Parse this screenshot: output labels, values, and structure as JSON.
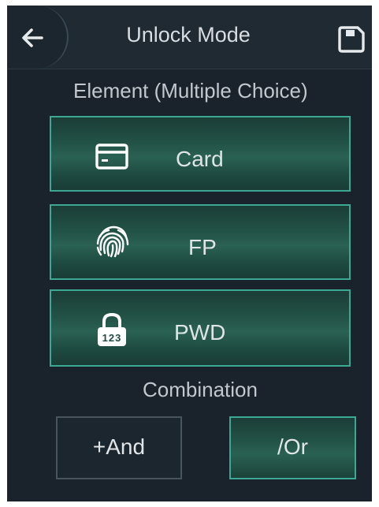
{
  "header": {
    "title": "Unlock Mode",
    "back_icon": "arrow-left-icon",
    "save_icon": "save-icon"
  },
  "element_section": {
    "label": "Element (Multiple Choice)",
    "options": [
      {
        "label": "Card",
        "icon": "card-icon",
        "selected": true
      },
      {
        "label": "FP",
        "icon": "fingerprint-icon",
        "selected": true
      },
      {
        "label": "PWD",
        "icon": "password-lock-icon",
        "selected": true
      }
    ]
  },
  "combination_section": {
    "label": "Combination",
    "and_label": "+And",
    "or_label": "/Or",
    "selected": "or"
  },
  "colors": {
    "background": "#1a232b",
    "accent_border": "#3aa892",
    "selected_fill": "#235347",
    "text": "#dfe4e6"
  }
}
